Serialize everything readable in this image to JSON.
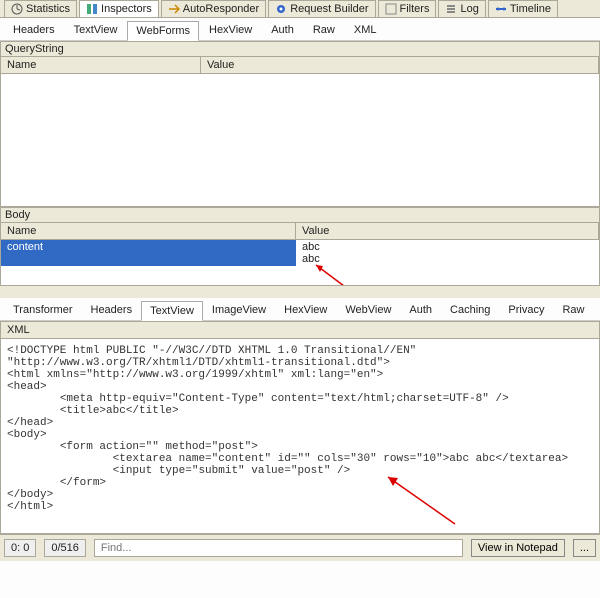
{
  "top_tabs": {
    "statistics": "Statistics",
    "inspectors": "Inspectors",
    "autoresponder": "AutoResponder",
    "request_builder": "Request Builder",
    "filters": "Filters",
    "log": "Log",
    "timeline": "Timeline"
  },
  "req_tabs": {
    "headers": "Headers",
    "textview": "TextView",
    "webforms": "WebForms",
    "hexview": "HexView",
    "auth": "Auth",
    "raw": "Raw",
    "xml": "XML"
  },
  "sections": {
    "querystring": "QueryString",
    "body": "Body"
  },
  "columns": {
    "name": "Name",
    "value": "Value"
  },
  "body_rows": [
    {
      "name": "content",
      "value": "abc\nabc"
    }
  ],
  "resp_tabs": {
    "transformer": "Transformer",
    "headers": "Headers",
    "textview": "TextView",
    "imageview": "ImageView",
    "hexview": "HexView",
    "webview": "WebView",
    "auth": "Auth",
    "caching": "Caching",
    "privacy": "Privacy",
    "raw": "Raw"
  },
  "xml_label": "XML",
  "source_html": "<!DOCTYPE html PUBLIC \"-//W3C//DTD XHTML 1.0 Transitional//EN\" \"http://www.w3.org/TR/xhtml1/DTD/xhtml1-transitional.dtd\">\n<html xmlns=\"http://www.w3.org/1999/xhtml\" xml:lang=\"en\">\n<head>\n        <meta http-equiv=\"Content-Type\" content=\"text/html;charset=UTF-8\" />\n        <title>abc</title>\n</head>\n<body>\n        <form action=\"\" method=\"post\">\n                <textarea name=\"content\" id=\"\" cols=\"30\" rows=\"10\">abc abc</textarea>\n                <input type=\"submit\" value=\"post\" />\n        </form>\n</body>\n</html>",
  "status": {
    "pos": "0: 0",
    "bytes": "0/516",
    "find_placeholder": "Find...",
    "view_btn": "View in Notepad",
    "more_btn": "..."
  }
}
